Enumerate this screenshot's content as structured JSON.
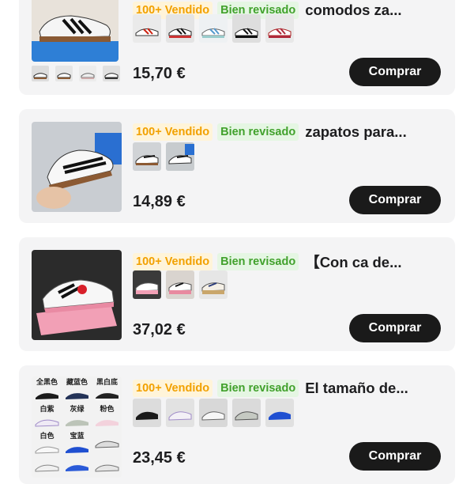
{
  "colors": {
    "card_bg": "#f4f4f5",
    "sold_badge_text": "#f2a100",
    "sold_badge_bg": "#fff4d9",
    "reviewed_badge_text": "#41a12c",
    "reviewed_badge_bg": "#e5f6e3",
    "buy_button_bg": "#1a1a1a",
    "price_text": "#1d1d1f"
  },
  "products": [
    {
      "sold_badge": "100+ Vendido",
      "review_badge": "Bien revisado",
      "title": "comodos za...",
      "price": "15,70 €",
      "buy_label": "Comprar",
      "variant_count": 5
    },
    {
      "sold_badge": "100+ Vendido",
      "review_badge": "Bien revisado",
      "title": "zapatos para...",
      "price": "14,89 €",
      "buy_label": "Comprar",
      "variant_count": 2
    },
    {
      "sold_badge": "100+ Vendido",
      "review_badge": "Bien revisado",
      "title": "【Con ca de...",
      "price": "37,02 €",
      "buy_label": "Comprar",
      "variant_count": 3
    },
    {
      "sold_badge": "100+ Vendido",
      "review_badge": "Bien revisado",
      "title": "El tamaño de...",
      "price": "23,45 €",
      "buy_label": "Comprar",
      "variant_count": 5,
      "image_grid_labels": [
        "全黑色",
        "藏蓝色",
        "黑白底",
        "白紫",
        "灰绿",
        "粉色",
        "白色",
        "宝蓝"
      ]
    }
  ]
}
